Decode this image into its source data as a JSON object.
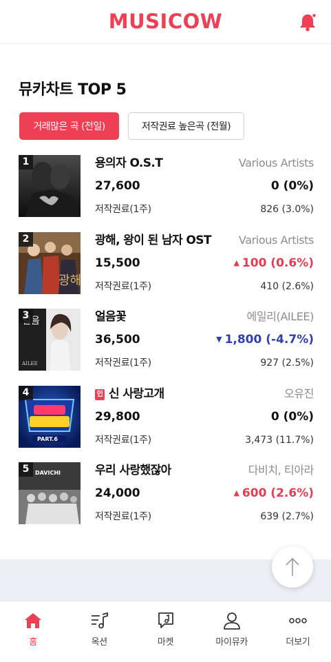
{
  "header": {
    "logo": "MUSICOW",
    "icons": {
      "notification": "bell-icon"
    },
    "accent_color": "#ef3f55"
  },
  "section": {
    "title": "뮤카차트 TOP 5"
  },
  "tabs": [
    {
      "label": "거래많은 곡 (전일)",
      "active": true
    },
    {
      "label": "저작권료 높은곡 (전월)",
      "active": false
    }
  ],
  "chart": [
    {
      "rank": "1",
      "title": "용의자 O.S.T",
      "artist": "Various Artists",
      "price": "27,600",
      "change": "0 (0%)",
      "direction": "flat",
      "meta_label": "저작권료(1주)",
      "meta_value": "826 (3.0%)"
    },
    {
      "rank": "2",
      "title": "광해, 왕이 된 남자 OST",
      "artist": "Various Artists",
      "price": "15,500",
      "change": "100 (0.6%)",
      "direction": "up",
      "meta_label": "저작권료(1주)",
      "meta_value": "410 (2.6%)"
    },
    {
      "rank": "3",
      "title": "얼음꽃",
      "artist": "에일리(AILEE)",
      "price": "36,500",
      "change": "1,800 (-4.7%)",
      "direction": "down",
      "meta_label": "저작권료(1주)",
      "meta_value": "927 (2.5%)"
    },
    {
      "rank": "4",
      "title": "신 사랑고개",
      "badge": "인",
      "artist": "오유진",
      "price": "29,800",
      "change": "0 (0%)",
      "direction": "flat",
      "meta_label": "저작권료(1주)",
      "meta_value": "3,473 (11.7%)"
    },
    {
      "rank": "5",
      "title": "우리 사랑했잖아",
      "artist": "다비치, 티아라",
      "price": "24,000",
      "change": "600 (2.6%)",
      "direction": "up",
      "meta_label": "저작권료(1주)",
      "meta_value": "639 (2.7%)"
    }
  ],
  "colors": {
    "up": "#e83b52",
    "down": "#2f3fb0"
  },
  "scroll_top": {
    "icon": "arrow-up-icon"
  },
  "bottom_nav": [
    {
      "label": "홈",
      "icon": "home-icon",
      "active": true
    },
    {
      "label": "옥션",
      "icon": "music-note-icon",
      "active": false
    },
    {
      "label": "마켓",
      "icon": "chat-music-icon",
      "active": false
    },
    {
      "label": "마이뮤카",
      "icon": "user-icon",
      "active": false
    },
    {
      "label": "더보기",
      "icon": "more-dots-icon",
      "active": false
    }
  ]
}
